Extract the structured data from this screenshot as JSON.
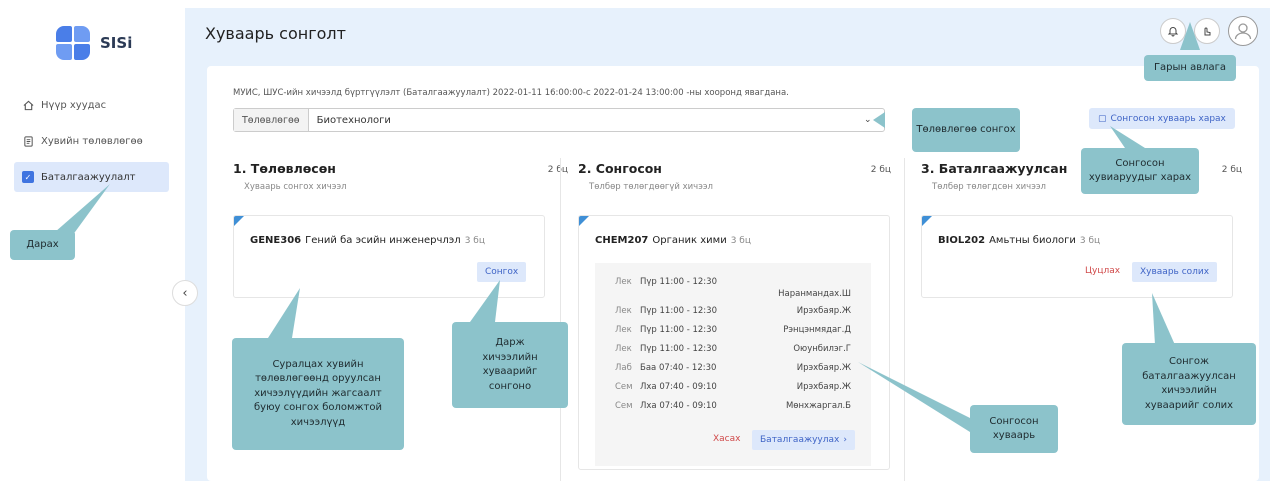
{
  "app": {
    "logo_text": "SISi"
  },
  "sidebar": {
    "items": [
      {
        "label": "Нүүр хуудас",
        "icon": "home-icon"
      },
      {
        "label": "Хувийн төлөвлөгөө",
        "icon": "document-icon"
      },
      {
        "label": "Баталгаажуулалт",
        "icon": "checkbox-icon",
        "active": true
      }
    ]
  },
  "header": {
    "title": "Хуваарь сонголт"
  },
  "notice": "МУИС, ШУС-ийн хичээлд бүртгүүлэлт (Баталгаажуулалт) 2022-01-11 16:00:00-с 2022-01-24 13:00:00 -ны хооронд явагдана.",
  "plan_select": {
    "label": "Төлөвлөгөө",
    "value": "Биотехнологи"
  },
  "view_selected_label": "Сонгосон хуваарь харах",
  "columns": [
    {
      "title": "1. Төлөвлөсөн",
      "subtitle": "Хуваарь сонгох хичээл",
      "count": "2 бц",
      "course": {
        "code": "GENE306",
        "name": "Гений ба эсийн инженерчлэл",
        "credits": "3 бц"
      },
      "select_label": "Сонгох"
    },
    {
      "title": "2. Сонгосон",
      "subtitle": "Төлбөр төлөгдөөгүй хичээл",
      "count": "2 бц",
      "course": {
        "code": "CHEM207",
        "name": "Органик хими",
        "credits": "3 бц"
      },
      "schedule": [
        {
          "type": "Лек",
          "time": "Пүр 11:00 - 12:30",
          "teacher": "Наранмандах.Ш"
        },
        {
          "type": "Лек",
          "time": "Пүр 11:00 - 12:30",
          "teacher": "Ирэхбаяр.Ж"
        },
        {
          "type": "Лек",
          "time": "Пүр 11:00 - 12:30",
          "teacher": "Рэнцэнмядаг.Д"
        },
        {
          "type": "Лек",
          "time": "Пүр 11:00 - 12:30",
          "teacher": "Оюунбилэг.Г"
        },
        {
          "type": "Лаб",
          "time": "Баа 07:40 - 12:30",
          "teacher": "Ирэхбаяр.Ж"
        },
        {
          "type": "Сем",
          "time": "Лха 07:40 - 09:10",
          "teacher": "Ирэхбаяр.Ж"
        },
        {
          "type": "Сем",
          "time": "Лха 07:40 - 09:10",
          "teacher": "Мөнхжаргал.Б"
        }
      ],
      "delete_label": "Хасах",
      "confirm_label": "Баталгаажуулах"
    },
    {
      "title": "3. Баталгаажуулсан",
      "subtitle": "Төлбөр төлөгдсөн хичээл",
      "count": "2 бц",
      "course": {
        "code": "BIOL202",
        "name": "Амьтны биологи",
        "credits": "3 бц"
      },
      "cancel_label": "Цуцлах",
      "change_label": "Хуваарь солих"
    }
  ],
  "callouts": {
    "manual": "Гарын авлага",
    "plan": "Төлөвлөгөө сонгох",
    "view_selected": "Сонгосон хувиаруудыг харах",
    "press": "Дарах",
    "planned_list": "Суралцах хувийн төлөвлөгөөнд оруулсан хичээлүүдийн жагсаалт буюу сонгох боломжтой хичээлүүд",
    "select": "Дарж хичээлийн хуваарийг сонгоно",
    "selected_schedule": "Сонгосон хуваарь",
    "change": "Сонгож баталгаажуулсан хичээлийн хуваарийг солих"
  },
  "colors": {
    "accent": "#3f74e0",
    "callout": "#8cc3cb",
    "background": "#e7f1fc",
    "danger": "#d04a4a"
  }
}
